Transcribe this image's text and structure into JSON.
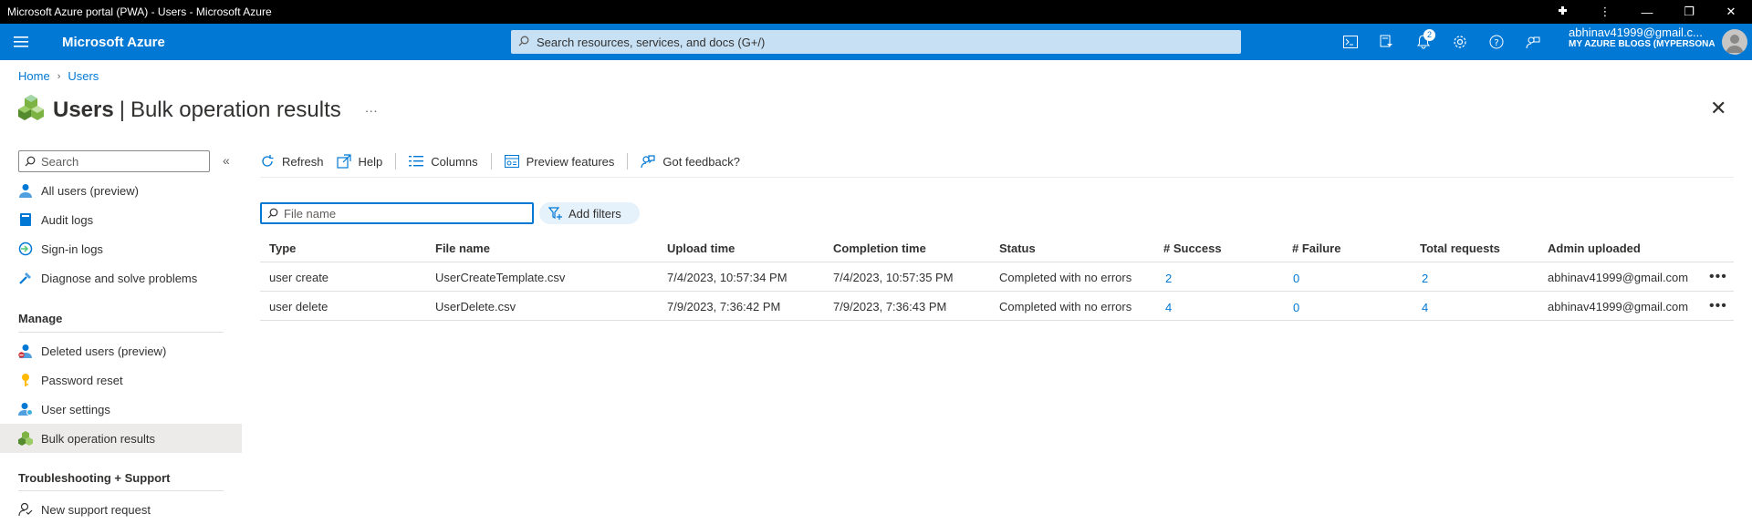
{
  "window": {
    "title": "Microsoft Azure portal (PWA) - Users - Microsoft Azure",
    "controls": [
      "extensions-icon",
      "more-icon",
      "minimize-icon",
      "restore-icon",
      "close-icon"
    ]
  },
  "topbar": {
    "brand": "Microsoft Azure",
    "search_placeholder": "Search resources, services, and docs (G+/)",
    "notifications_count": "2",
    "account_email": "abhinav41999@gmail.c...",
    "account_org": "MY AZURE BLOGS (MYPERSONA..."
  },
  "breadcrumb": {
    "home": "Home",
    "current": "Users"
  },
  "page": {
    "title_main": "Users",
    "title_separator": "|",
    "title_sub": "Bulk operation results",
    "ellipsis": "···"
  },
  "sidebar": {
    "search_placeholder": "Search",
    "items_top": [
      {
        "label": "All users (preview)",
        "icon": "user-icon"
      },
      {
        "label": "Audit logs",
        "icon": "book-icon"
      },
      {
        "label": "Sign-in logs",
        "icon": "signin-icon"
      },
      {
        "label": "Diagnose and solve problems",
        "icon": "wrench-icon"
      }
    ],
    "manage_header": "Manage",
    "items_manage": [
      {
        "label": "Deleted users (preview)",
        "icon": "deleted-user-icon"
      },
      {
        "label": "Password reset",
        "icon": "key-icon"
      },
      {
        "label": "User settings",
        "icon": "user-settings-icon"
      },
      {
        "label": "Bulk operation results",
        "icon": "cubes-icon"
      }
    ],
    "support_header": "Troubleshooting + Support",
    "items_support": [
      {
        "label": "New support request",
        "icon": "support-icon"
      }
    ]
  },
  "toolbar": {
    "refresh": "Refresh",
    "help": "Help",
    "columns": "Columns",
    "preview_features": "Preview features",
    "feedback": "Got feedback?"
  },
  "filters": {
    "file_name_placeholder": "File name",
    "add_filters": "Add filters"
  },
  "table": {
    "headers": [
      "Type",
      "File name",
      "Upload time",
      "Completion time",
      "Status",
      "# Success",
      "# Failure",
      "Total requests",
      "Admin uploaded"
    ],
    "rows": [
      [
        "user create",
        "UserCreateTemplate.csv",
        "7/4/2023, 10:57:34 PM",
        "7/4/2023, 10:57:35 PM",
        "Completed with no errors",
        "2",
        "0",
        "2",
        "abhinav41999@gmail.com"
      ],
      [
        "user delete",
        "UserDelete.csv",
        "7/9/2023, 7:36:42 PM",
        "7/9/2023, 7:36:43 PM",
        "Completed with no errors",
        "4",
        "0",
        "4",
        "abhinav41999@gmail.com"
      ]
    ]
  },
  "colors": {
    "topbar": "#0078d4",
    "link": "#0078d4",
    "active_nav": "#edebe9"
  }
}
